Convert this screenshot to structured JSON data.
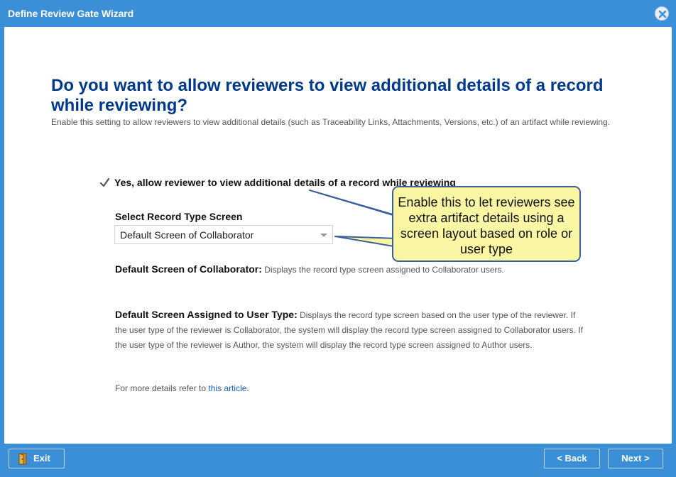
{
  "window": {
    "title": "Define Review Gate Wizard"
  },
  "main": {
    "heading": "Do you want to allow reviewers to view additional details of a record while reviewing?",
    "description": "Enable this setting to allow reviewers to view additional details (such as Traceability Links, Attachments, Versions, etc.) of an artifact while reviewing.",
    "checkbox_label": "Yes, allow reviewer to view additional details of a record while reviewing",
    "checkbox_checked": true,
    "select_label": "Select Record Type Screen",
    "select_value": "Default Screen of Collaborator",
    "option1_title": "Default Screen of Collaborator:",
    "option1_text": " Displays the record type screen assigned to Collaborator users.",
    "option2_title": "Default Screen Assigned to User Type:",
    "option2_text": " Displays the record type screen based on the user type of the reviewer. If the user type of the reviewer is Collaborator, the system will display the record type screen assigned to Collaborator users. If the user type of the reviewer is Author, the system will display the record type screen assigned to Author users.",
    "more_prefix": "For more details refer to ",
    "more_link": "this article",
    "more_suffix": "."
  },
  "callout": {
    "text": "Enable this to let reviewers see extra artifact details using a screen layout based on role or user type"
  },
  "footer": {
    "exit_label": "Exit",
    "back_label": "< Back",
    "next_label": "Next >"
  },
  "colors": {
    "accent": "#3a8fd6",
    "heading": "#003a8c",
    "callout_fill": "#fbf6a3",
    "callout_border": "#3a5f9c",
    "link": "#1a5fb4"
  },
  "icons": {
    "close": "close-icon",
    "check": "checkmark-icon",
    "exit": "exit-door-icon",
    "dropdown": "chevron-down-icon"
  }
}
